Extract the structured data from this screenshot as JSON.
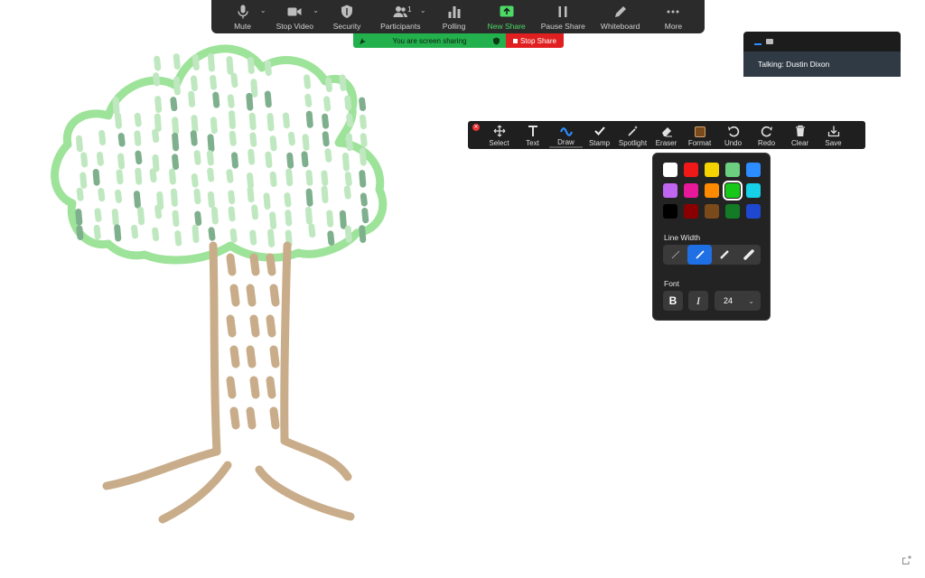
{
  "meeting_toolbar": {
    "items": [
      {
        "label": "Mute",
        "icon": "microphone-icon"
      },
      {
        "label": "Stop Video",
        "icon": "video-camera-icon"
      },
      {
        "label": "Security",
        "icon": "shield-icon"
      },
      {
        "label": "Participants",
        "icon": "participants-icon",
        "count": "1"
      },
      {
        "label": "Polling",
        "icon": "bar-chart-icon"
      },
      {
        "label": "New Share",
        "icon": "share-up-arrow-icon"
      },
      {
        "label": "Pause Share",
        "icon": "pause-icon"
      },
      {
        "label": "Whiteboard",
        "icon": "pencil-icon"
      },
      {
        "label": "More",
        "icon": "ellipsis-icon"
      }
    ],
    "accent_color": "#4cd964"
  },
  "share_banner": {
    "status_text": "You are screen sharing",
    "stop_label": "Stop Share",
    "status_color": "#23b14d",
    "stop_color": "#e02020"
  },
  "talking_panel": {
    "text": "Talking: Dustin Dixon"
  },
  "annotation_toolbar": {
    "items": [
      {
        "label": "Select",
        "icon": "move-arrows-icon"
      },
      {
        "label": "Text",
        "icon": "text-t-icon"
      },
      {
        "label": "Draw",
        "icon": "squiggle-icon"
      },
      {
        "label": "Stamp",
        "icon": "checkmark-icon"
      },
      {
        "label": "Spotlight",
        "icon": "magic-wand-icon"
      },
      {
        "label": "Eraser",
        "icon": "eraser-icon"
      },
      {
        "label": "Format",
        "icon": "format-swatch-icon"
      },
      {
        "label": "Undo",
        "icon": "undo-icon"
      },
      {
        "label": "Redo",
        "icon": "redo-icon"
      },
      {
        "label": "Clear",
        "icon": "trash-icon"
      },
      {
        "label": "Save",
        "icon": "save-download-icon"
      }
    ],
    "active": "Draw"
  },
  "format_popup": {
    "colors": [
      "#ffffff",
      "#f01818",
      "#f5d300",
      "#6ccf7f",
      "#2d8cff",
      "#c065f0",
      "#e8189a",
      "#ff8a00",
      "#18c818",
      "#16d0e8",
      "#000000",
      "#8a0000",
      "#7a4a1a",
      "#137a26",
      "#1e48d0"
    ],
    "selected_color_index": 8,
    "line_width_label": "Line Width",
    "line_width_selected_index": 1,
    "font_label": "Font",
    "bold_label": "B",
    "italic_label": "I",
    "font_size": "24"
  },
  "drawing": {
    "canopy_color": "#9ee39a",
    "leaf_color": "#bfe8c0",
    "trunk_color": "#c9ad8a"
  }
}
